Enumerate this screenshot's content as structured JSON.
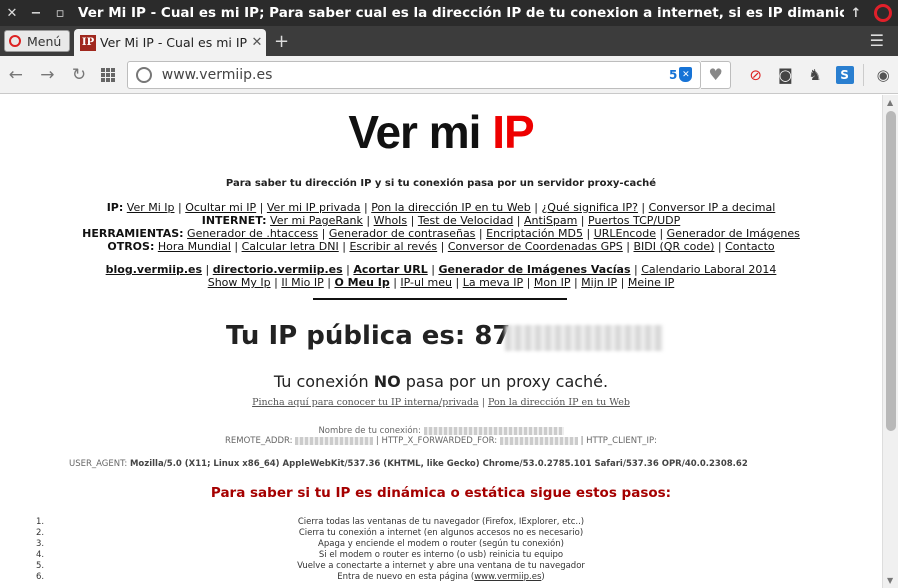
{
  "window": {
    "title": "Ver Mi IP - Cual es mi IP; Para saber cual es la dirección IP de tu conexion a internet, si es IP dimanica o IP estáti"
  },
  "tabs": {
    "menu_label": "Menú",
    "active_tab_title": "Ver Mi IP - Cual es mi IP;",
    "favicon_text": "IP"
  },
  "toolbar": {
    "url": "www.vermiip.es",
    "badge_count": "5"
  },
  "page": {
    "logo_black": "Ver mi ",
    "logo_red": "IP",
    "tagline": "Para saber tu dirección IP y si tu conexión pasa por un servidor proxy-caché",
    "nav_rows": [
      {
        "label": "IP:",
        "links": [
          "Ver Mi Ip",
          "Ocultar mi IP",
          "Ver mi IP privada",
          "Pon la dirección IP en tu Web",
          "¿Qué significa IP?",
          "Conversor IP a decimal"
        ]
      },
      {
        "label": "INTERNET:",
        "links": [
          "Ver mi PageRank",
          "WhoIs",
          "Test de Velocidad",
          "AntiSpam",
          "Puertos TCP/UDP"
        ]
      },
      {
        "label": "HERRAMIENTAS:",
        "links": [
          "Generador de .htaccess",
          "Generador de contraseñas",
          "Encriptación MD5",
          "URLEncode",
          "Generador de Imágenes"
        ]
      },
      {
        "label": "OTROS:",
        "links": [
          "Hora Mundial",
          "Calcular letra DNI",
          "Escribir al revés",
          "Conversor de Coordenadas GPS",
          "BIDI (QR code)",
          "Contacto"
        ]
      }
    ],
    "sister_sites": [
      "blog.vermiip.es",
      "directorio.vermiip.es",
      "Acortar URL",
      "Generador de Imágenes Vacías"
    ],
    "sister_plain": "Calendario Laboral 2014",
    "languages": [
      "Show My Ip",
      "Il Mio IP",
      "O Meu Ip",
      "IP-ul meu",
      "La meva IP",
      "Mon IP",
      "Mijn IP",
      "Meine IP"
    ],
    "ip_label": "Tu IP pública es: 87.",
    "proxy_pre": "Tu conexión ",
    "proxy_bold": "NO",
    "proxy_post": " pasa por un proxy caché.",
    "sublink_1": "Pincha aquí para conocer tu IP interna/privada",
    "sublink_2": "Pon la dirección IP en tu Web",
    "conn_name_label": "Nombre de tu conexión:",
    "remote_addr_label": "REMOTE_ADDR:",
    "forwarded_label": "HTTP_X_FORWARDED_FOR:",
    "client_ip_label": "HTTP_CLIENT_IP:",
    "user_agent_label": "USER_AGENT:",
    "user_agent_value": "Mozilla/5.0 (X11; Linux x86_64) AppleWebKit/537.36 (KHTML, like Gecko) Chrome/53.0.2785.101 Safari/537.36 OPR/40.0.2308.62",
    "steps_title": "Para saber si tu IP es dinámica o estática sigue estos pasos:",
    "steps": [
      "Cierra todas las ventanas de tu navegador (Firefox, IExplorer, etc..)",
      "Cierra tu conexión a internet (en algunos accesos no es necesario)",
      "Apaga y enciende el modem o router (según tu conexión)",
      "Si el modem o router es interno (o usb) reinicia tu equipo",
      "Vuelve a conectarte a internet y abre una ventana de tu navegador",
      "Entra de nuevo en esta página"
    ],
    "step6_link": "www.vermiip.es"
  }
}
